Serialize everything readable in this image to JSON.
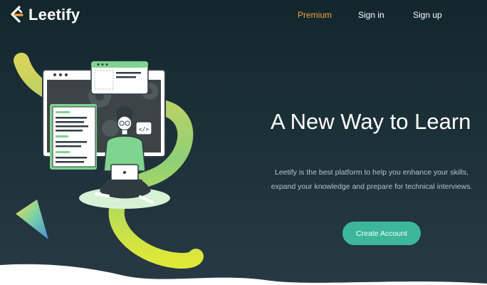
{
  "brand": {
    "name": "Leetify"
  },
  "nav": {
    "premium": "Premium",
    "sign_in": "Sign in",
    "sign_up": "Sign up"
  },
  "hero": {
    "headline": "A New Way to Learn",
    "description": "Leetify is the best platform to help you enhance your skills, expand your knowledge and prepare for technical interviews.",
    "cta": "Create Account",
    "code_icon_text": "</>"
  },
  "colors": {
    "background": "#1c3038",
    "accent_green": "#3cb79a",
    "premium_orange": "#f0a43a",
    "illustration_green": "#7fd48f",
    "illustration_yellow": "#d6e04a"
  },
  "icons": [
    "leetify-logo-icon",
    "code-brackets-icon",
    "gear-icon",
    "laptop-icon"
  ]
}
